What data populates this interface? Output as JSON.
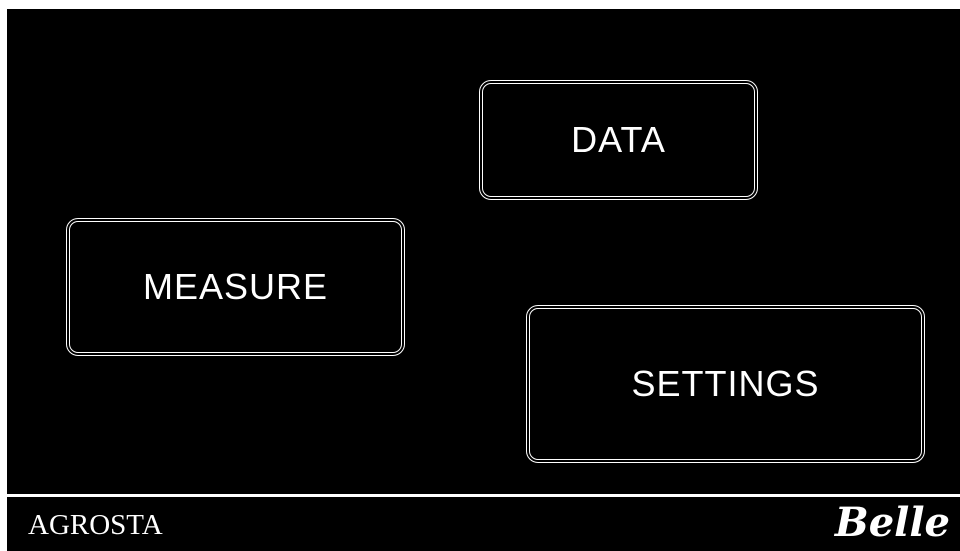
{
  "menu": {
    "data_label": "DATA",
    "measure_label": "MEASURE",
    "settings_label": "SETTINGS"
  },
  "footer": {
    "brand_left": "AGROSTA",
    "brand_right": "Belle"
  },
  "colors": {
    "background": "#000000",
    "foreground": "#ffffff"
  }
}
